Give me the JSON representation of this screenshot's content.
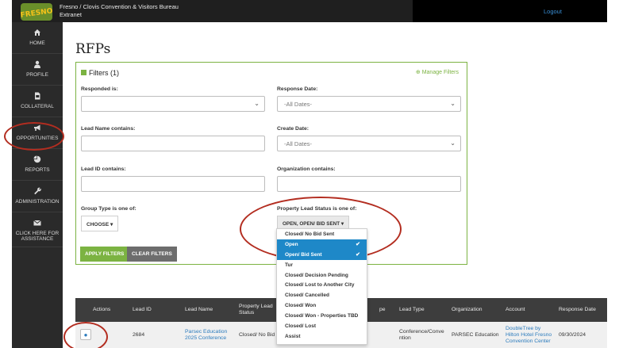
{
  "header": {
    "org_line1": "Fresno / Clovis Convention & Visitors Bureau",
    "org_line2": "Extranet",
    "logout": "Logout",
    "logo_text": "FRESNO"
  },
  "sidebar": {
    "items": [
      {
        "label": "HOME",
        "icon": "home-icon"
      },
      {
        "label": "PROFILE",
        "icon": "user-icon"
      },
      {
        "label": "COLLATERAL",
        "icon": "file-icon"
      },
      {
        "label": "OPPORTUNITIES",
        "icon": "megaphone-icon"
      },
      {
        "label": "REPORTS",
        "icon": "pie-chart-icon"
      },
      {
        "label": "ADMINISTRATION",
        "icon": "wrench-icon"
      },
      {
        "label": "CLICK HERE FOR ASSISTANCE",
        "icon": "envelope-icon"
      }
    ]
  },
  "page": {
    "title": "RFPs"
  },
  "filters": {
    "title": "Filters",
    "count": "(1)",
    "manage": "Manage Filters",
    "responded_label": "Responded is:",
    "response_date_label": "Response Date:",
    "response_date_value": "-All Dates-",
    "lead_name_label": "Lead Name contains:",
    "create_date_label": "Create Date:",
    "create_date_value": "-All Dates-",
    "lead_id_label": "Lead ID contains:",
    "org_label": "Organization contains:",
    "group_type_label": "Group Type is one of:",
    "choose": "CHOOSE",
    "status_label": "Property Lead Status is one of:",
    "status_value": "OPEN, OPEN/ BID SENT",
    "apply": "APPLY FILTERS",
    "clear": "CLEAR FILTERS"
  },
  "status_options": [
    {
      "label": "Closed/ No Bid Sent",
      "selected": false
    },
    {
      "label": "Open",
      "selected": true
    },
    {
      "label": "Open/ Bid Sent",
      "selected": true
    },
    {
      "label": "Tur",
      "selected": false
    },
    {
      "label": "Closed/ Decision Pending",
      "selected": false
    },
    {
      "label": "Closed/ Lost to Another City",
      "selected": false
    },
    {
      "label": "Closed/ Cancelled",
      "selected": false
    },
    {
      "label": "Closed/ Won",
      "selected": false
    },
    {
      "label": "Closed/ Won - Properties TBD",
      "selected": false
    },
    {
      "label": "Closed/ Lost",
      "selected": false
    },
    {
      "label": "Assist",
      "selected": false
    }
  ],
  "table": {
    "headers": {
      "actions": "Actions",
      "lead_id": "Lead ID",
      "lead_name": "Lead Name",
      "status": "Property Lead Status",
      "type_partial": "pe",
      "lead_type": "Lead Type",
      "organization": "Organization",
      "account": "Account",
      "response_date": "Response Date"
    },
    "rows": [
      {
        "lead_id": "2684",
        "lead_name": "Parsec Education 2025 Conference",
        "status": "Closed/ No Bid S",
        "lead_type": "Conference/Convention",
        "organization": "PARSEC Education",
        "account": "DoubleTree by Hilton Hotel Fresno Convention Center",
        "response_date": "09/30/2024"
      }
    ]
  },
  "colors": {
    "accent_green": "#7cb342",
    "selected_blue": "#1e88c8",
    "annotation_red": "#b32d20",
    "sidebar_bg": "#2a2a2a"
  }
}
